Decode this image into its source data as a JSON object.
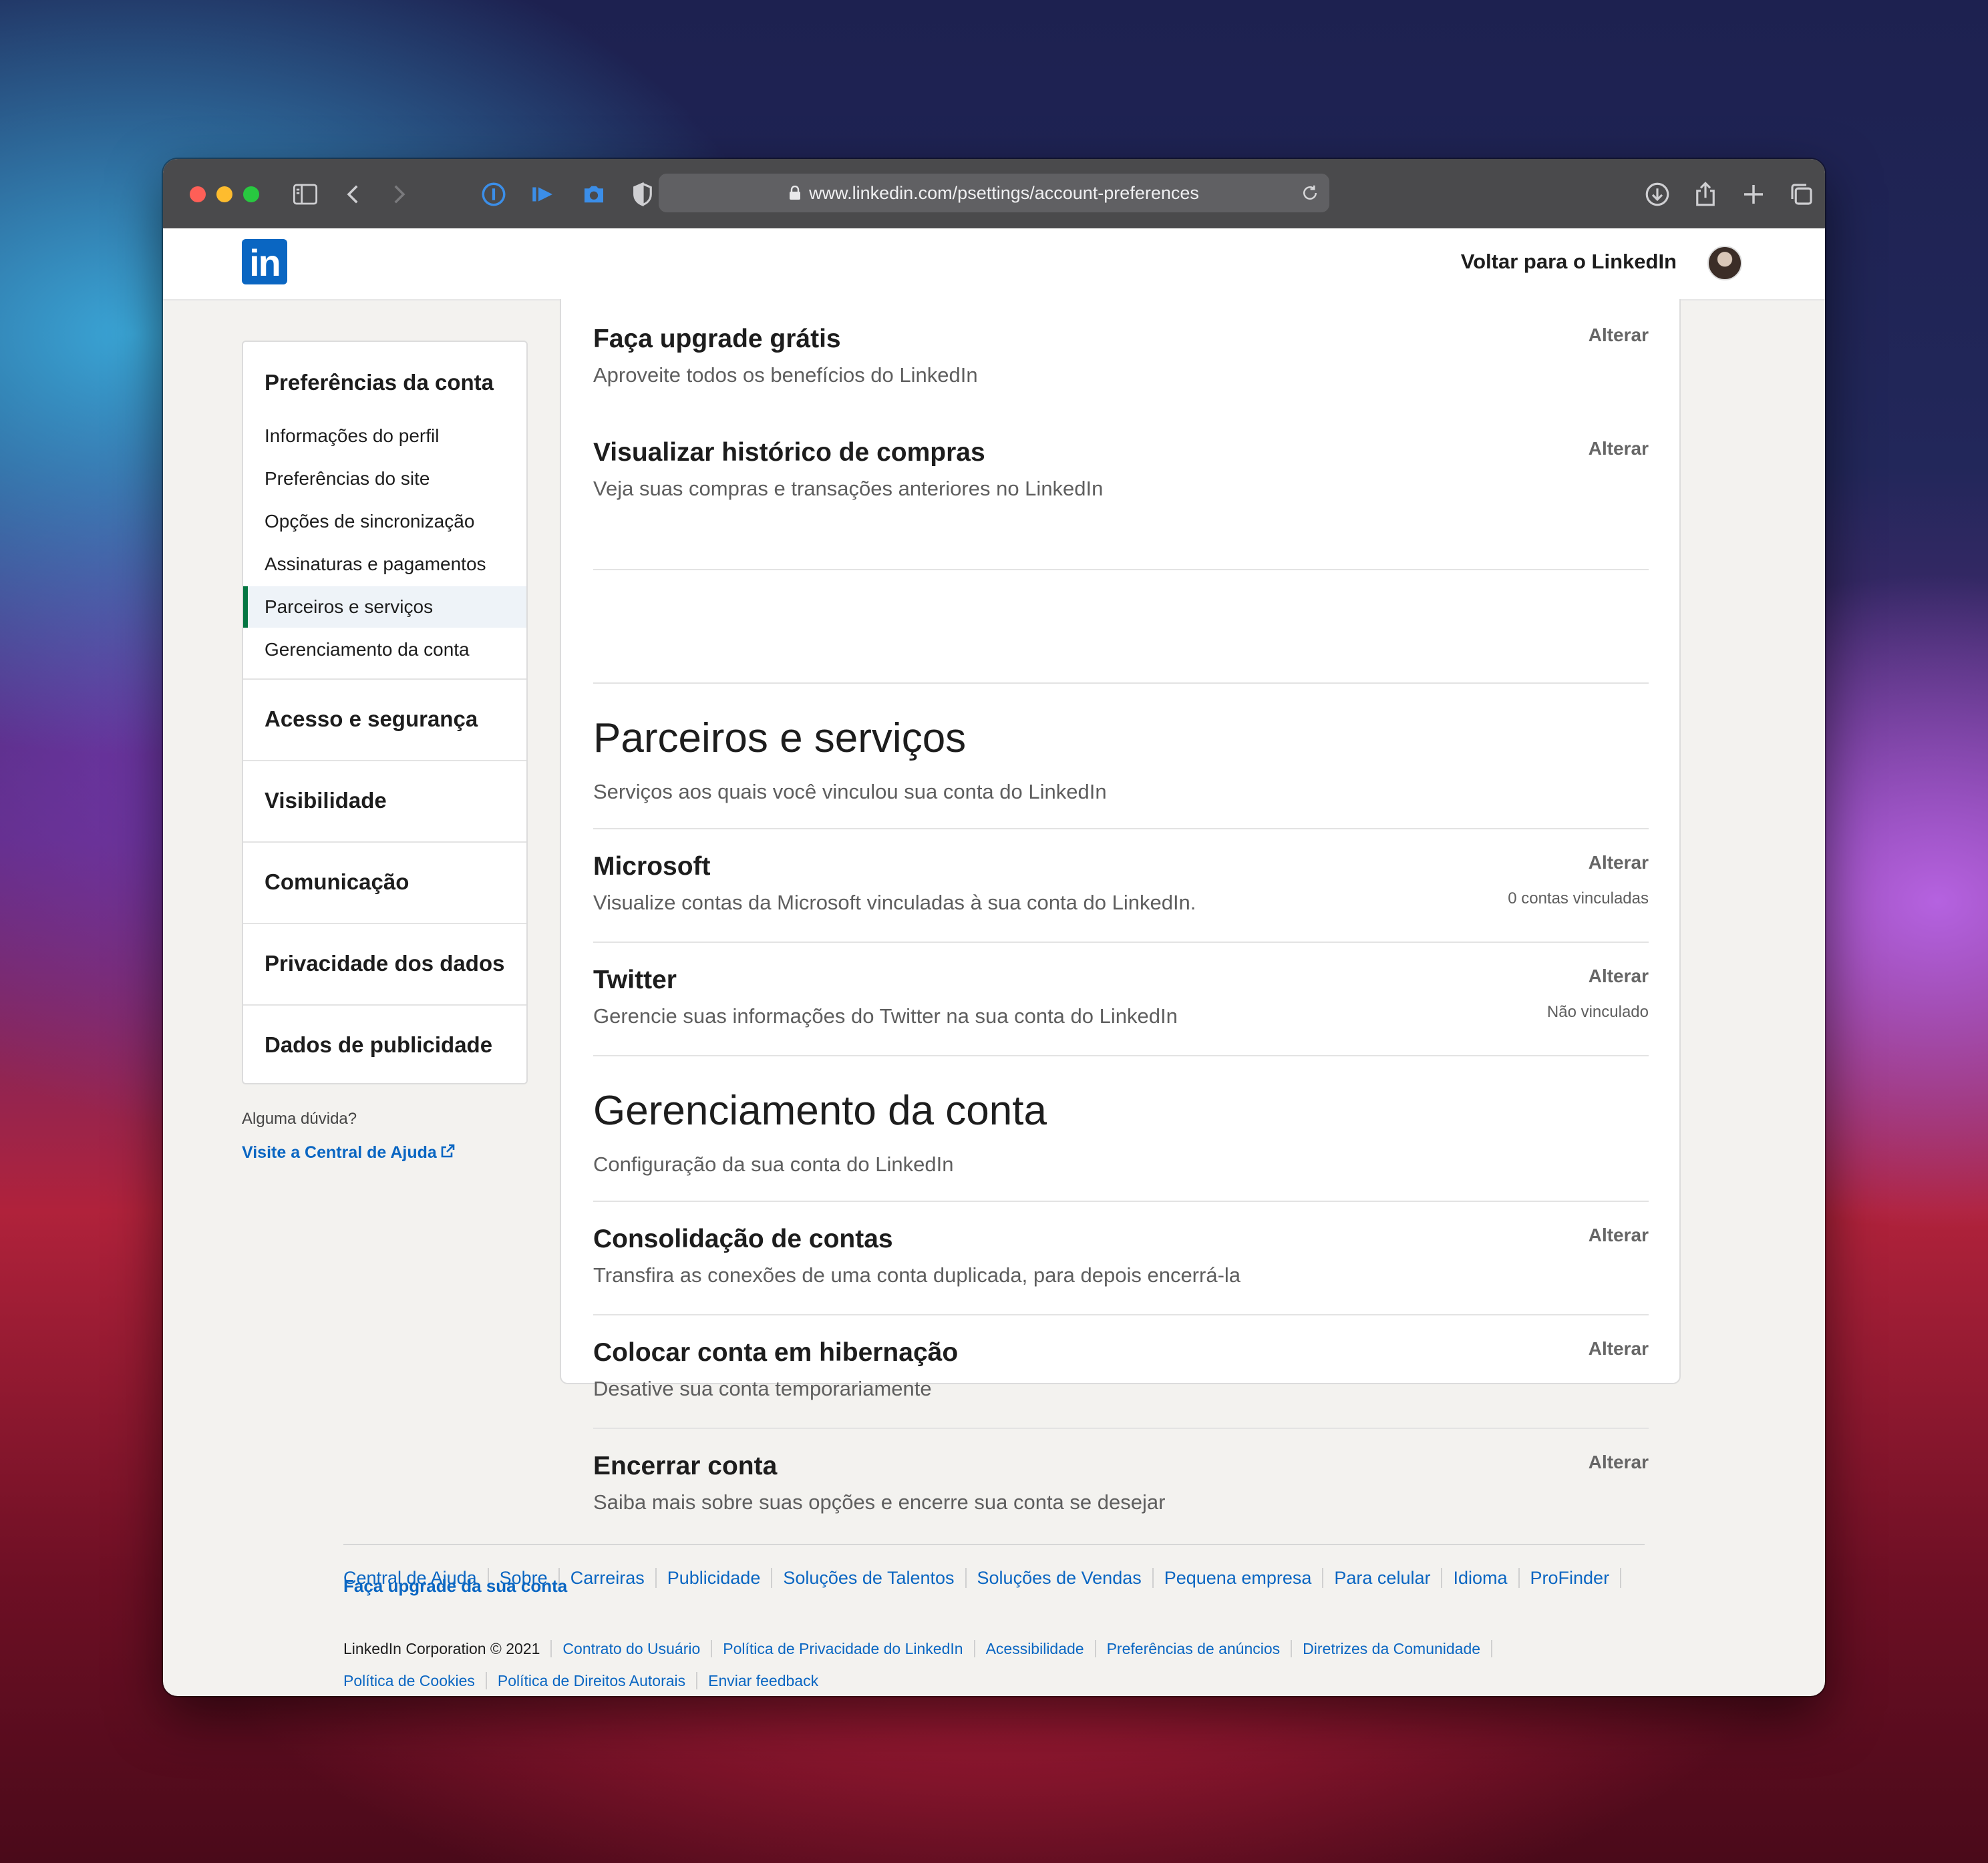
{
  "browser": {
    "url": "www.linkedin.com/psettings/account-preferences"
  },
  "header": {
    "logo_text": "in",
    "back_link": "Voltar para o LinkedIn"
  },
  "sidebar": {
    "main_title": "Preferências da conta",
    "items": [
      {
        "label": "Informações do perfil"
      },
      {
        "label": "Preferências do site"
      },
      {
        "label": "Opções de sincronização"
      },
      {
        "label": "Assinaturas e pagamentos"
      },
      {
        "label": "Parceiros e serviços",
        "active": true
      },
      {
        "label": "Gerenciamento da conta"
      }
    ],
    "sections": [
      {
        "label": "Acesso e segurança"
      },
      {
        "label": "Visibilidade"
      },
      {
        "label": "Comunicação"
      },
      {
        "label": "Privacidade dos dados"
      },
      {
        "label": "Dados de publicidade"
      }
    ],
    "help_question": "Alguma dúvida?",
    "help_link": "Visite a Central de Ajuda"
  },
  "content": {
    "rows_top": [
      {
        "title": "Faça upgrade grátis",
        "desc": "Aproveite todos os benefícios do LinkedIn",
        "action": "Alterar"
      },
      {
        "title": "Visualizar histórico de compras",
        "desc": "Veja suas compras e transações anteriores no LinkedIn",
        "action": "Alterar"
      }
    ],
    "partners": {
      "title": "Parceiros e serviços",
      "subtitle": "Serviços aos quais você vinculou sua conta do LinkedIn",
      "rows": [
        {
          "title": "Microsoft",
          "desc": "Visualize contas da Microsoft vinculadas à sua conta do LinkedIn.",
          "action": "Alterar",
          "status": "0 contas vinculadas"
        },
        {
          "title": "Twitter",
          "desc": "Gerencie suas informações do Twitter na sua conta do LinkedIn",
          "action": "Alterar",
          "status": "Não vinculado"
        }
      ]
    },
    "account": {
      "title": "Gerenciamento da conta",
      "subtitle": "Configuração da sua conta do LinkedIn",
      "rows": [
        {
          "title": "Consolidação de contas",
          "desc": "Transfira as conexões de uma conta duplicada, para depois encerrá-la",
          "action": "Alterar"
        },
        {
          "title": "Colocar conta em hibernação",
          "desc": "Desative sua conta temporariamente",
          "action": "Alterar"
        },
        {
          "title": "Encerrar conta",
          "desc": "Saiba mais sobre suas opções e encerre sua conta se desejar",
          "action": "Alterar"
        }
      ]
    }
  },
  "footer": {
    "links_row1": [
      "Central de Ajuda",
      "Sobre",
      "Carreiras",
      "Publicidade",
      "Soluções de Talentos",
      "Soluções de Vendas",
      "Pequena empresa",
      "Para celular",
      "Idioma",
      "ProFinder"
    ],
    "upgrade": "Faça upgrade da sua conta",
    "copyright": "LinkedIn Corporation © 2021",
    "links_row3": [
      "Contrato do Usuário",
      "Política de Privacidade do LinkedIn",
      "Acessibilidade",
      "Preferências de anúncios",
      "Diretrizes da Comunidade"
    ],
    "links_row4": [
      "Política de Cookies",
      "Política de Direitos Autorais",
      "Enviar feedback"
    ]
  },
  "colors": {
    "linkedin_blue": "#0a66c2",
    "active_indicator": "#057642"
  }
}
